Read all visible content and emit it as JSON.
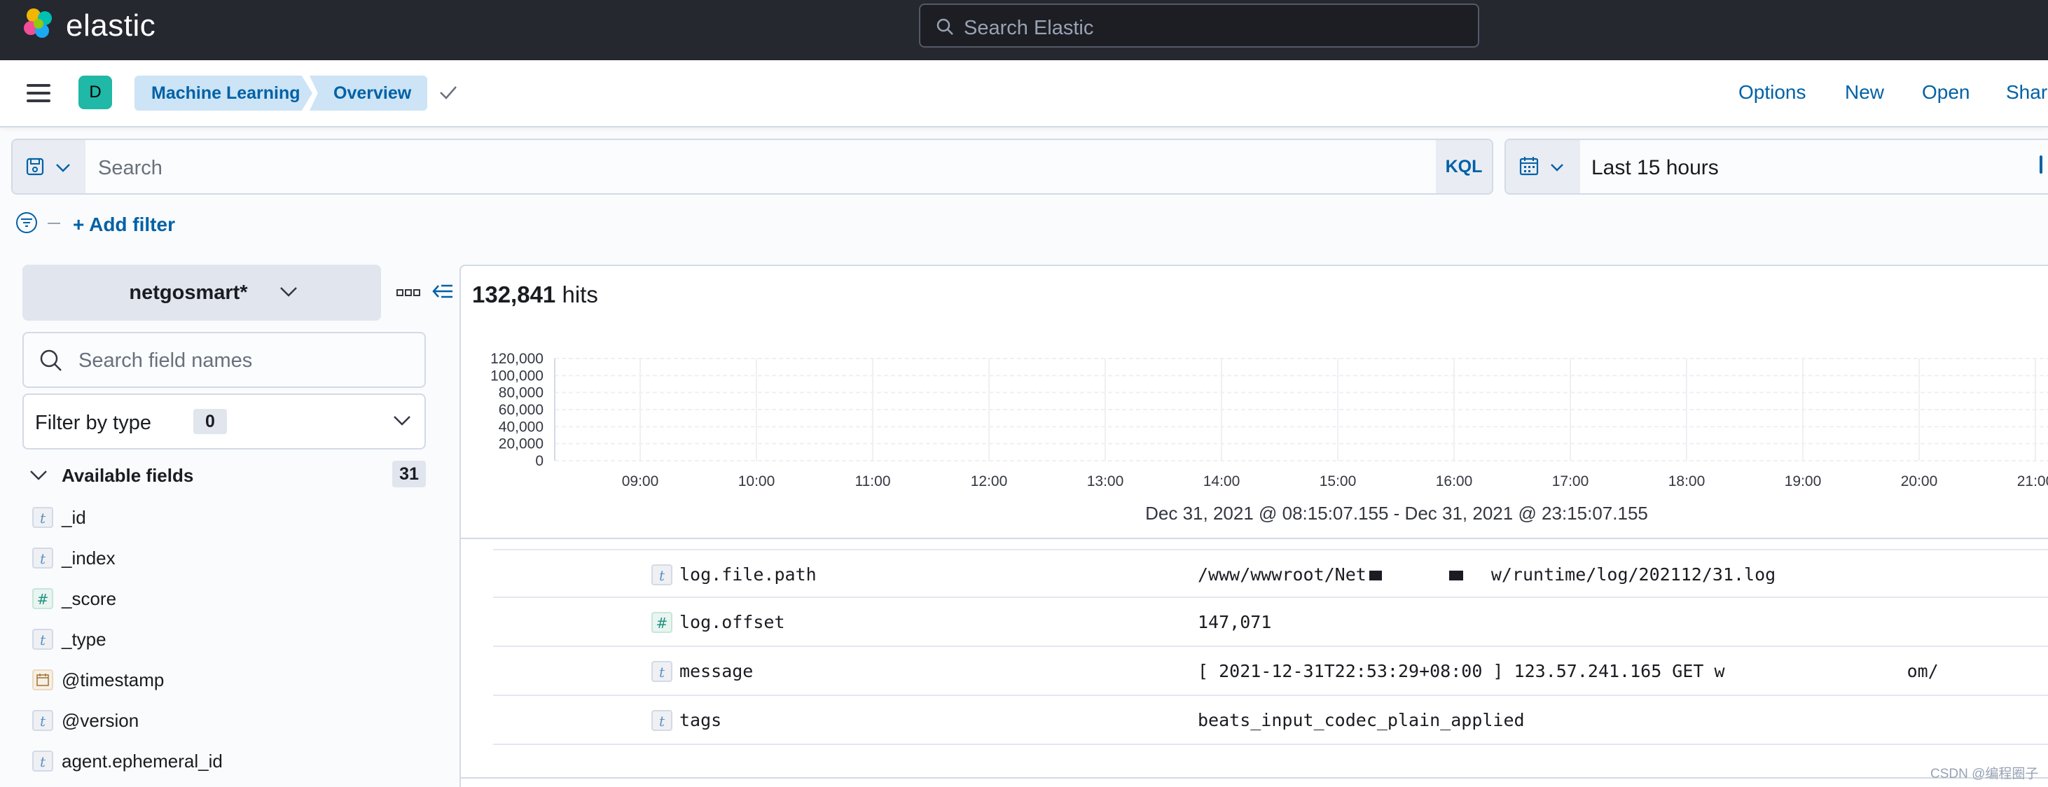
{
  "header": {
    "brand": "elastic",
    "search_placeholder": "Search Elastic"
  },
  "subheader": {
    "space_initial": "D",
    "breadcrumbs": [
      "Machine Learning",
      "Overview"
    ],
    "links": [
      "Options",
      "New",
      "Open",
      "Shar"
    ]
  },
  "query": {
    "placeholder": "Search",
    "language": "KQL",
    "time_range": "Last 15 hours",
    "add_filter": "+ Add filter"
  },
  "sidebar": {
    "index_pattern": "netgosmart*",
    "field_search_placeholder": "Search field names",
    "filter_by_type": "Filter by type",
    "filter_count": "0",
    "available_title": "Available fields",
    "available_count": "31",
    "fields": [
      {
        "name": "_id",
        "type": "t"
      },
      {
        "name": "_index",
        "type": "t"
      },
      {
        "name": "_score",
        "type": "#"
      },
      {
        "name": "_type",
        "type": "t"
      },
      {
        "name": "@timestamp",
        "type": "date"
      },
      {
        "name": "@version",
        "type": "t"
      },
      {
        "name": "agent.ephemeral_id",
        "type": "t"
      }
    ]
  },
  "main": {
    "hits_count": "132,841",
    "hits_label": "hits",
    "time_span": "Dec 31, 2021 @ 08:15:07.155 - Dec 31, 2021 @ 23:15:07.155",
    "doc_rows": [
      {
        "key": "log.file.path",
        "type": "t",
        "value_start": "/www/wwwroot/Net",
        "value_end": "w/runtime/log/202112/31.log"
      },
      {
        "key": "log.offset",
        "type": "#",
        "value_start": "147,071",
        "value_end": ""
      },
      {
        "key": "message",
        "type": "t",
        "value_start": "[ 2021-12-31T22:53:29+08:00 ] 123.57.241.165 GET w",
        "value_end": "om/"
      },
      {
        "key": "tags",
        "type": "t",
        "value_start": "beats_input_codec_plain_applied",
        "value_end": ""
      }
    ]
  },
  "chart_data": {
    "type": "bar",
    "title": "",
    "xlabel": "",
    "ylabel": "",
    "categories": [
      "09:00",
      "10:00",
      "11:00",
      "12:00",
      "13:00",
      "14:00",
      "15:00",
      "16:00",
      "17:00",
      "18:00",
      "19:00",
      "20:00",
      "21:00"
    ],
    "x_ticks": [
      "09:00",
      "10:00",
      "11:00",
      "12:00",
      "13:00",
      "14:00",
      "15:00",
      "16:00",
      "17:00",
      "18:00",
      "19:00",
      "20:00",
      "21:00"
    ],
    "y_ticks": [
      "120,000",
      "100,000",
      "80,000",
      "60,000",
      "40,000",
      "20,000",
      "0"
    ],
    "values": [
      0,
      0,
      0,
      0,
      0,
      0,
      0,
      0,
      0,
      0,
      0,
      0,
      0
    ],
    "ylim": [
      0,
      120000
    ],
    "grid": true
  },
  "watermark": "CSDN @编程圈子",
  "colors": {
    "header_bg": "#25282f",
    "link": "#0061a6",
    "breadcrumb_bg": "#cce4f5",
    "avatar": "#20b8a6"
  }
}
